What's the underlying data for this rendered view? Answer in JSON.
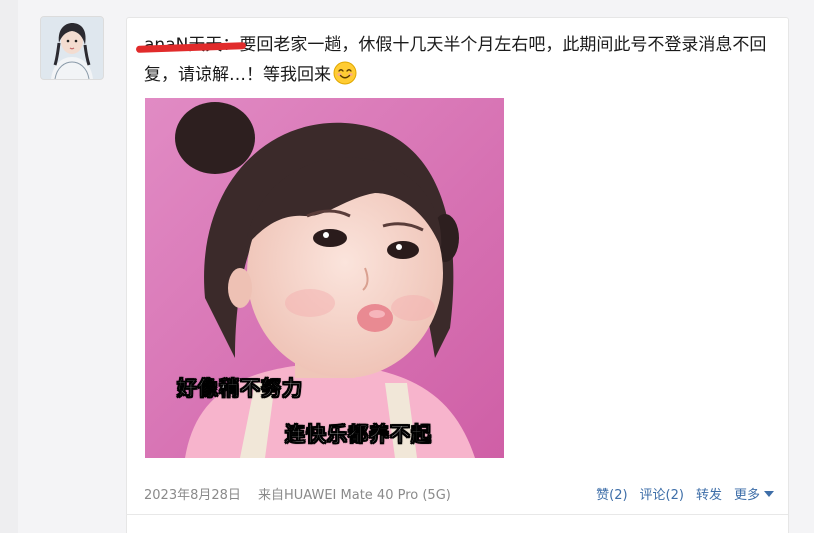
{
  "post": {
    "author": "anaN天天",
    "text": "：要回老家一趟，休假十几天半个月左右吧，此期间此号不登录消息不回复，请谅解…！等我回来",
    "emoji": "smile-emoji",
    "image": {
      "caption_1": "好像稍不努力",
      "caption_2": "连快乐都养不起"
    },
    "date": "2023年8月28日",
    "source": "来自HUAWEI Mate 40 Pro (5G)",
    "actions": {
      "like": "赞(2)",
      "comment": "评论(2)",
      "repost": "转发",
      "more": "更多"
    }
  },
  "colors": {
    "link": "#3e6ea8",
    "redact": "#e12b2b",
    "photo_bg": "#d86fb0"
  }
}
